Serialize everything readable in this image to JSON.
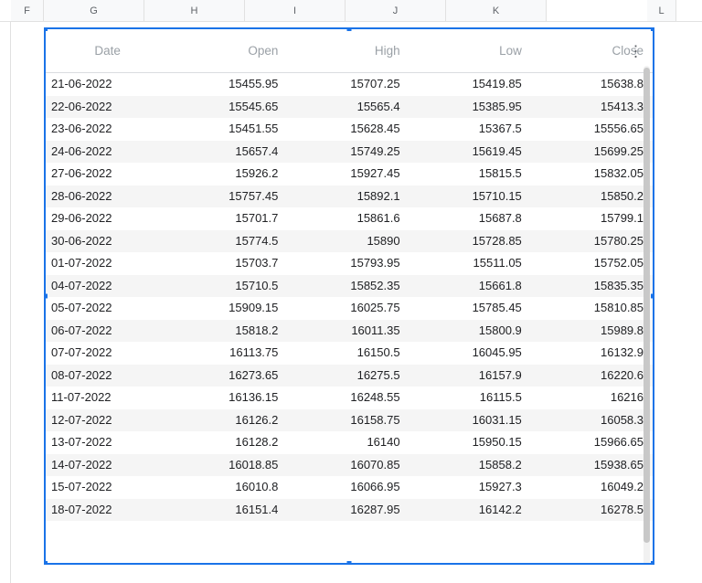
{
  "column_letters": [
    "F",
    "G",
    "H",
    "I",
    "J",
    "K",
    "L"
  ],
  "table": {
    "headers": {
      "date": "Date",
      "open": "Open",
      "high": "High",
      "low": "Low",
      "close": "Close"
    },
    "rows": [
      {
        "date": "21-06-2022",
        "open": "15455.95",
        "high": "15707.25",
        "low": "15419.85",
        "close": "15638.8"
      },
      {
        "date": "22-06-2022",
        "open": "15545.65",
        "high": "15565.4",
        "low": "15385.95",
        "close": "15413.3"
      },
      {
        "date": "23-06-2022",
        "open": "15451.55",
        "high": "15628.45",
        "low": "15367.5",
        "close": "15556.65"
      },
      {
        "date": "24-06-2022",
        "open": "15657.4",
        "high": "15749.25",
        "low": "15619.45",
        "close": "15699.25"
      },
      {
        "date": "27-06-2022",
        "open": "15926.2",
        "high": "15927.45",
        "low": "15815.5",
        "close": "15832.05"
      },
      {
        "date": "28-06-2022",
        "open": "15757.45",
        "high": "15892.1",
        "low": "15710.15",
        "close": "15850.2"
      },
      {
        "date": "29-06-2022",
        "open": "15701.7",
        "high": "15861.6",
        "low": "15687.8",
        "close": "15799.1"
      },
      {
        "date": "30-06-2022",
        "open": "15774.5",
        "high": "15890",
        "low": "15728.85",
        "close": "15780.25"
      },
      {
        "date": "01-07-2022",
        "open": "15703.7",
        "high": "15793.95",
        "low": "15511.05",
        "close": "15752.05"
      },
      {
        "date": "04-07-2022",
        "open": "15710.5",
        "high": "15852.35",
        "low": "15661.8",
        "close": "15835.35"
      },
      {
        "date": "05-07-2022",
        "open": "15909.15",
        "high": "16025.75",
        "low": "15785.45",
        "close": "15810.85"
      },
      {
        "date": "06-07-2022",
        "open": "15818.2",
        "high": "16011.35",
        "low": "15800.9",
        "close": "15989.8"
      },
      {
        "date": "07-07-2022",
        "open": "16113.75",
        "high": "16150.5",
        "low": "16045.95",
        "close": "16132.9"
      },
      {
        "date": "08-07-2022",
        "open": "16273.65",
        "high": "16275.5",
        "low": "16157.9",
        "close": "16220.6"
      },
      {
        "date": "11-07-2022",
        "open": "16136.15",
        "high": "16248.55",
        "low": "16115.5",
        "close": "16216"
      },
      {
        "date": "12-07-2022",
        "open": "16126.2",
        "high": "16158.75",
        "low": "16031.15",
        "close": "16058.3"
      },
      {
        "date": "13-07-2022",
        "open": "16128.2",
        "high": "16140",
        "low": "15950.15",
        "close": "15966.65"
      },
      {
        "date": "14-07-2022",
        "open": "16018.85",
        "high": "16070.85",
        "low": "15858.2",
        "close": "15938.65"
      },
      {
        "date": "15-07-2022",
        "open": "16010.8",
        "high": "16066.95",
        "low": "15927.3",
        "close": "16049.2"
      },
      {
        "date": "18-07-2022",
        "open": "16151.4",
        "high": "16287.95",
        "low": "16142.2",
        "close": "16278.5"
      }
    ]
  }
}
